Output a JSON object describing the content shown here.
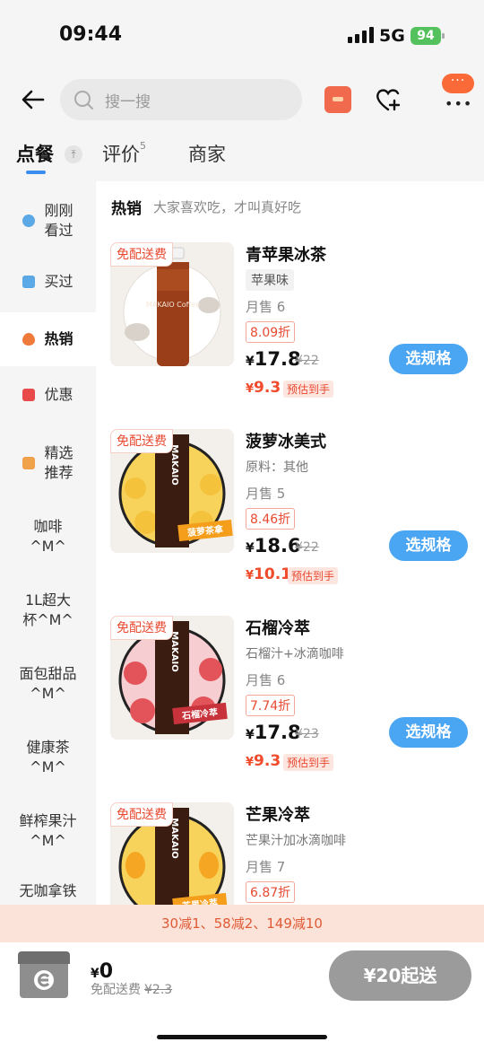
{
  "status": {
    "time": "09:44",
    "network": "5G",
    "battery": "94"
  },
  "header": {
    "search_placeholder": "搜一搜",
    "more_label": "···"
  },
  "tabs": [
    {
      "label": "点餐",
      "active": true
    },
    {
      "label": "评价",
      "count": "5"
    },
    {
      "label": "商家"
    }
  ],
  "sidebar": [
    {
      "label": "刚刚\n看过",
      "icon": "eye-icon",
      "color": "#5aa9e6"
    },
    {
      "label": "买过",
      "icon": "bag-icon",
      "color": "#5aa9e6"
    },
    {
      "label": "热销",
      "icon": "flame-icon",
      "color": "#f07a3a",
      "active": true
    },
    {
      "label": "优惠",
      "icon": "coupon-icon",
      "color": "#e84a4a"
    },
    {
      "label": "精选\n推荐",
      "icon": "thumb-icon",
      "color": "#f0a24a"
    },
    {
      "label": "咖啡\n^M^"
    },
    {
      "label": "1L超大\n杯^M^"
    },
    {
      "label": "面包甜品\n^M^"
    },
    {
      "label": "健康茶\n^M^"
    },
    {
      "label": "鲜榨果汁\n^M^"
    },
    {
      "label": "无咖拿铁"
    }
  ],
  "section": {
    "title": "热销",
    "subtitle": "大家喜欢吃，才叫真好吃"
  },
  "products": [
    {
      "badge": "免配送费",
      "name": "青苹果冰茶",
      "tag": "苹果味",
      "desc": "",
      "sold": "月售 6",
      "discount": "8.09折",
      "currency": "¥",
      "price": "17.8",
      "original": "¥22",
      "final_currency": "¥",
      "final": "9.3",
      "est_label": "预估到手",
      "button": "选规格",
      "bottle_text": "MAKAIO Coffee"
    },
    {
      "badge": "免配送费",
      "name": "菠萝冰美式",
      "tag": "",
      "desc": "原料：其他",
      "sold": "月售 5",
      "discount": "8.46折",
      "currency": "¥",
      "price": "18.6",
      "original": "¥22",
      "final_currency": "¥",
      "final": "10.1",
      "est_label": "预估到手",
      "button": "选规格",
      "bottle_text": "MAKAIO",
      "label_text": "菠萝茶拿"
    },
    {
      "badge": "免配送费",
      "name": "石榴冷萃",
      "tag": "",
      "desc": "石榴汁+冰滴咖啡",
      "sold": "月售 6",
      "discount": "7.74折",
      "currency": "¥",
      "price": "17.8",
      "original": "¥23",
      "final_currency": "¥",
      "final": "9.3",
      "est_label": "预估到手",
      "button": "选规格",
      "bottle_text": "MAKAIO",
      "label_text": "石榴冷萃"
    },
    {
      "badge": "免配送费",
      "name": "芒果冷萃",
      "tag": "",
      "desc": "芒果汁加冰滴咖啡",
      "sold": "月售 7",
      "discount": "6.87折",
      "bottle_text": "MAKAIO",
      "label_text": "芒果冷萃"
    }
  ],
  "promo": "30减1、58减2、149减10",
  "cart": {
    "currency": "¥",
    "total": "0",
    "delivery_label": "免配送费",
    "delivery_original": "¥2.3",
    "checkout": "¥20起送"
  },
  "colors": {
    "accent_blue": "#4aa5f2",
    "price_red": "#f04b2a",
    "checkout_gray": "#9b9b9b",
    "promo_bg": "#fbe3d9"
  }
}
